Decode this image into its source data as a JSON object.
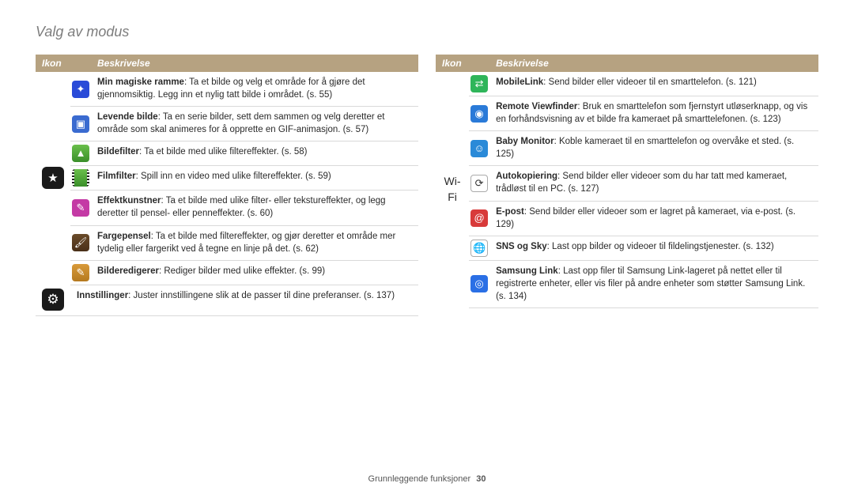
{
  "page_title": "Valg av modus",
  "headers": {
    "icon": "Ikon",
    "desc": "Beskrivelse"
  },
  "wifi_label": "Wi-Fi",
  "footer": {
    "text": "Grunnleggende funksjoner",
    "page": "30"
  },
  "left": {
    "magic_star": {
      "items": [
        {
          "title": "Min magiske ramme",
          "body": ": Ta et bilde og velg et område for å gjøre det gjennomsiktig. Legg inn et nylig tatt bilde i området. (s. 55)"
        },
        {
          "title": "Levende bilde",
          "body": ": Ta en serie bilder, sett dem sammen og velg deretter et område som skal animeres for å opprette en GIF-animasjon. (s. 57)"
        },
        {
          "title": "Bildefilter",
          "body": ": Ta et bilde med ulike filtereffekter. (s. 58)"
        },
        {
          "title": "Filmfilter",
          "body": ": Spill inn en video med ulike filtereffekter. (s. 59)"
        },
        {
          "title": "Effektkunstner",
          "body": ": Ta et bilde med ulike filter- eller tekstureffekter, og legg deretter til pensel- eller penneffekter. (s. 60)"
        },
        {
          "title": "Fargepensel",
          "body": ": Ta et bilde med filtereffekter, og gjør deretter et område mer tydelig eller fargerikt ved å tegne en linje på det. (s. 62)"
        },
        {
          "title": "Bilderedigerer",
          "body": ": Rediger bilder med ulike effekter. (s. 99)"
        }
      ]
    },
    "settings": {
      "title": "Innstillinger",
      "body": ": Juster innstillingene slik at de passer til dine preferanser. (s. 137)"
    }
  },
  "right": {
    "wifi": {
      "items": [
        {
          "title": "MobileLink",
          "body": ": Send bilder eller videoer til en smarttelefon. (s. 121)"
        },
        {
          "title": "Remote Viewfinder",
          "body": ": Bruk en smarttelefon som fjernstyrt utløserknapp, og vis en forhåndsvisning av et bilde fra kameraet på smarttelefonen. (s. 123)"
        },
        {
          "title": "Baby Monitor",
          "body": ": Koble kameraet til en smarttelefon og overvåke et sted. (s. 125)"
        },
        {
          "title": "Autokopiering",
          "body": ": Send bilder eller videoer som du har tatt med kameraet, trådløst til en PC. (s. 127)"
        },
        {
          "title": "E-post",
          "body": ": Send bilder eller videoer som er lagret på kameraet, via e-post. (s. 129)"
        },
        {
          "title": "SNS og Sky",
          "body": ": Last opp bilder og videoer til fildelingstjenester. (s. 132)"
        },
        {
          "title": "Samsung Link",
          "body": ": Last opp filer til Samsung Link-lageret på nettet eller til registrerte enheter, eller vis filer på andre enheter som støtter Samsung Link. (s. 134)"
        }
      ]
    }
  }
}
